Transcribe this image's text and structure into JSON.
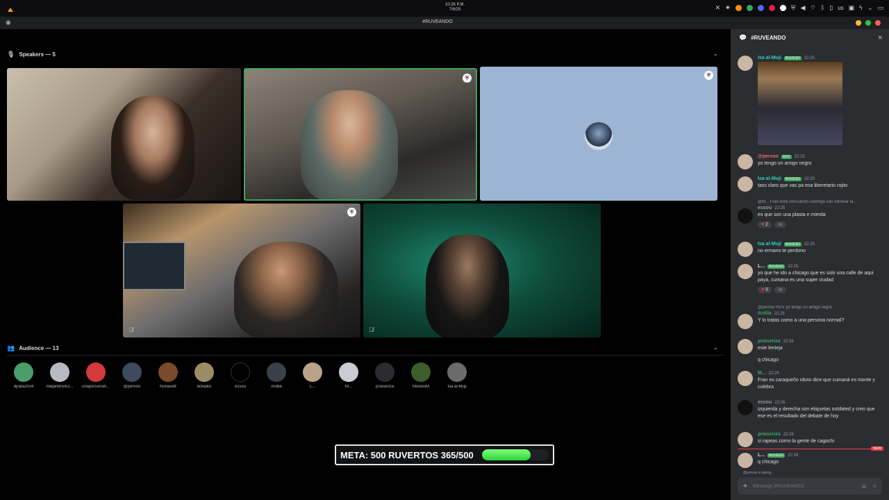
{
  "system": {
    "time": "10:26 P.M.",
    "date": "7/6/25",
    "keyboard_layout": "us"
  },
  "window": {
    "title": "#RUVEANDO"
  },
  "stage": {
    "speakers_heading": "Speakers — 5",
    "audience_heading": "Audience — 13",
    "audience": [
      {
        "name": "djrata2004",
        "color": "#4a9d6a"
      },
      {
        "name": "Alejandro/Ex...",
        "color": "#b9b9c3"
      },
      {
        "name": "unapersonan...",
        "color": "#d33a3a"
      },
      {
        "name": "@pervoo",
        "color": "#3e4a5e"
      },
      {
        "name": "Nonavelt",
        "color": "#7a4a2c"
      },
      {
        "name": "eckalko",
        "color": "#9a8c66"
      },
      {
        "name": "essou",
        "color": "#000000"
      },
      {
        "name": "Ardila",
        "color": "#3c3f4c"
      },
      {
        "name": "L...",
        "color": "#b8a389"
      },
      {
        "name": "M...",
        "color": "#c9ccd3"
      },
      {
        "name": "praiseriza",
        "color": "#2d2a30"
      },
      {
        "name": "MoisesM",
        "color": "#3c5e2c"
      },
      {
        "name": "Isa al-Muji",
        "color": "#6b6b6b"
      }
    ],
    "goal": {
      "text": "META: 500 RUVERTOS 365/500",
      "progress": 0.73
    }
  },
  "chat": {
    "channel": "#RUVEANDO",
    "input_placeholder": "Message #RUVEANDO",
    "typing": "@pervoo is typing...",
    "new_label": "NEW",
    "messages": [
      {
        "author": "Isa al-Muji",
        "tag": "RUVESO",
        "time": "22:25",
        "text": "",
        "color": "#2dd4bf",
        "has_image": true
      },
      {
        "author": "@pervoo",
        "tag": "RUV",
        "time": "22:25",
        "text": "yo tengo un amigo negro",
        "color": "#e06c75"
      },
      {
        "author": "Isa al-Muji",
        "tag": "RUVESO",
        "time": "22:25",
        "text": "tass claro que vas pa esa liberetario rojito",
        "color": "#2dd4bf"
      },
      {
        "author": "essou",
        "tag": "",
        "time": "22:25",
        "text": "es que son una plasta e mierda",
        "color": "#949ba4",
        "reply": "@M... Fran está concuerdo conmigo con eliminar la...",
        "reactions": [
          "2"
        ]
      },
      {
        "author": "Isa al-Muji",
        "tag": "RUVESO",
        "time": "22:25",
        "text": "no ermano te perdono",
        "color": "#2dd4bf"
      },
      {
        "author": "L...",
        "tag": "RUVESO",
        "time": "22:25",
        "text": "yo que he ido a chicago que es solo una calle de aqui paya, cumana es una super ciudad",
        "color": "#dbdee1",
        "reactions": [
          "5"
        ]
      },
      {
        "author": "Ardila",
        "tag": "",
        "time": "22:26",
        "text": "Y lo tratas como a una persona normal?",
        "color": "#3ba55d",
        "reply": "@pervoo RUV yo tengo un amigo negro"
      },
      {
        "author": "praiseriza",
        "tag": "",
        "time": "22:26",
        "text": "este lenteja",
        "color": "#3ba55d"
      },
      {
        "author": "",
        "tag": "",
        "time": "",
        "text": "q chicago",
        "color": "#dbdee1"
      },
      {
        "author": "M...",
        "tag": "",
        "time": "22:26",
        "text": "Fran es caraqueño obvio dice que cumaná es monte y culebra",
        "color": "#3ba55d"
      },
      {
        "author": "essou",
        "tag": "",
        "time": "22:26",
        "text": "izquierda y derecha son etiquetas outdated y creo que ese es el resultado del debate de hoy",
        "color": "#949ba4"
      },
      {
        "author": "praiseriza",
        "tag": "",
        "time": "22:26",
        "text": "si rapeas como la gente de cagochi",
        "color": "#3ba55d"
      },
      {
        "author": "L...",
        "tag": "RUVESO",
        "time": "22:26",
        "text": "q chicago",
        "color": "#dbdee1"
      }
    ]
  }
}
